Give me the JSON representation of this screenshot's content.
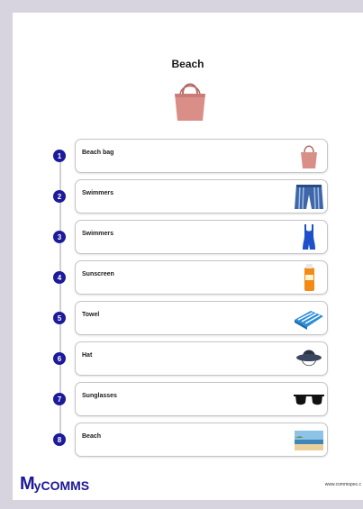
{
  "page": {
    "title": "Beach",
    "hero_icon": "beach-bag-icon"
  },
  "items": [
    {
      "number": "1",
      "label": "Beach bag",
      "icon": "beach-bag-icon"
    },
    {
      "number": "2",
      "label": "Swimmers",
      "icon": "board-shorts-icon"
    },
    {
      "number": "3",
      "label": "Swimmers",
      "icon": "swimsuit-icon"
    },
    {
      "number": "4",
      "label": "Sunscreen",
      "icon": "sunscreen-icon"
    },
    {
      "number": "5",
      "label": "Towel",
      "icon": "towel-icon"
    },
    {
      "number": "6",
      "label": "Hat",
      "icon": "bucket-hat-icon"
    },
    {
      "number": "7",
      "label": "Sunglasses",
      "icon": "sunglasses-icon"
    },
    {
      "number": "8",
      "label": "Beach",
      "icon": "beach-photo-icon"
    }
  ],
  "footer": {
    "logo_m": "M",
    "logo_rest": "yCOMMS",
    "url": "www.commopec.c"
  },
  "colors": {
    "accent": "#1d1b9a",
    "background": "#d7d3df"
  }
}
